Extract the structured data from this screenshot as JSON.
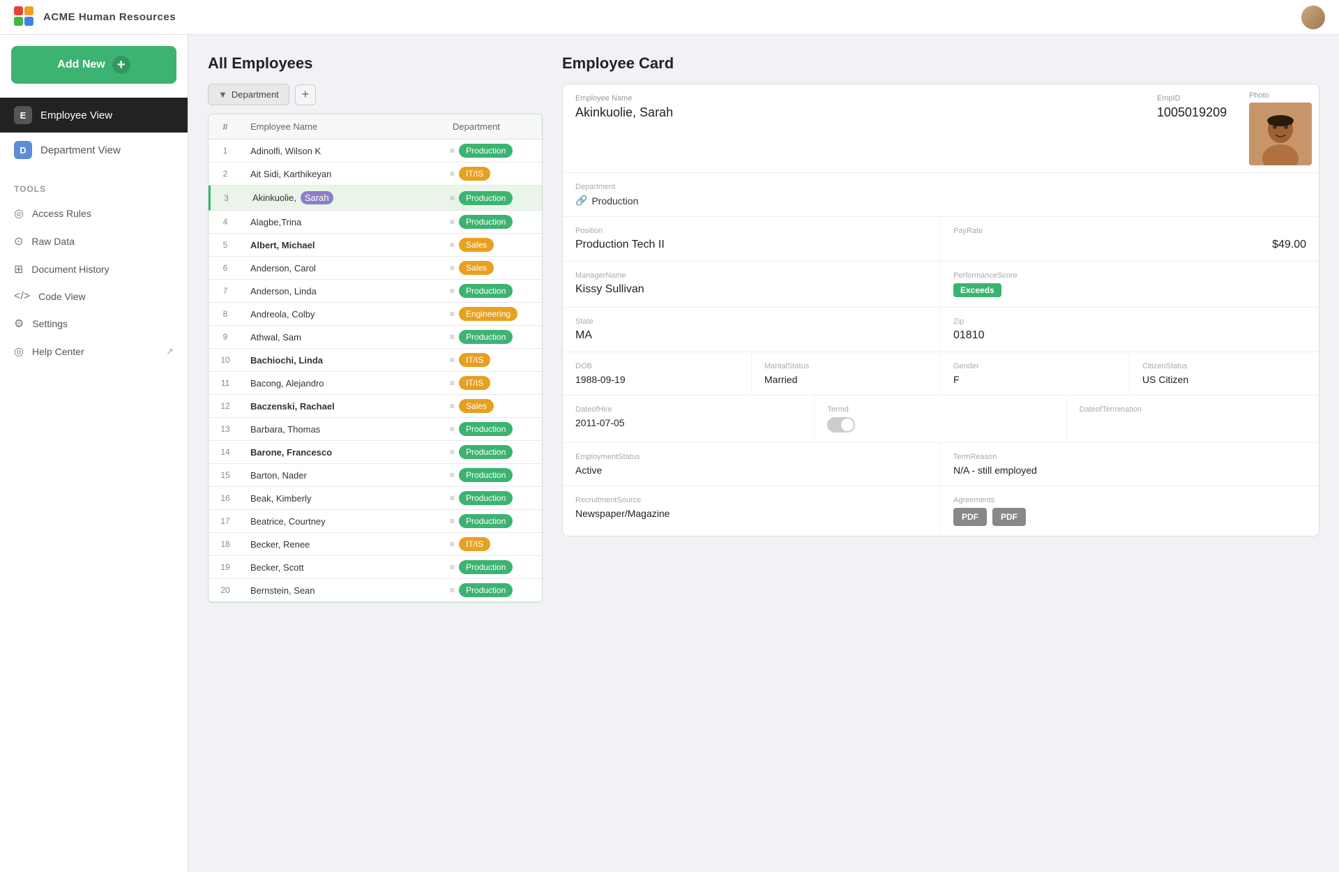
{
  "app": {
    "title": "ACME Human Resources",
    "logo_unicode": "⊞"
  },
  "topbar": {
    "avatar_alt": "User Avatar"
  },
  "sidebar": {
    "add_new_label": "Add New",
    "add_new_plus": "+",
    "nav_items": [
      {
        "id": "employee-view",
        "label": "Employee View",
        "icon": "E",
        "active": true
      },
      {
        "id": "department-view",
        "label": "Department View",
        "icon": "D",
        "active": false
      }
    ],
    "tools_label": "TOOLS",
    "tools": [
      {
        "id": "access-rules",
        "label": "Access Rules",
        "icon": "◎"
      },
      {
        "id": "raw-data",
        "label": "Raw Data",
        "icon": "⊙"
      },
      {
        "id": "document-history",
        "label": "Document History",
        "icon": "⊞"
      },
      {
        "id": "code-view",
        "label": "Code View",
        "icon": "</>"
      },
      {
        "id": "settings",
        "label": "Settings",
        "icon": "⚙"
      },
      {
        "id": "help-center",
        "label": "Help Center",
        "icon": "◎",
        "has_ext": true
      }
    ]
  },
  "employees_section": {
    "title": "All Employees",
    "filter_label": "Department",
    "filter_icon": "▼",
    "add_filter": "+",
    "columns": [
      "Employee Name",
      "Department"
    ],
    "employees": [
      {
        "num": 1,
        "name": "Adinolfi, Wilson  K",
        "bold": false,
        "dept": "Production",
        "dept_class": "production"
      },
      {
        "num": 2,
        "name": "Ait Sidi, Karthikeyan",
        "bold": false,
        "dept": "IT/IS",
        "dept_class": "it"
      },
      {
        "num": 3,
        "name": "Akinkuolie, Sarah",
        "bold": false,
        "dept": "Production",
        "dept_class": "production",
        "selected": true
      },
      {
        "num": 4,
        "name": "Alagbe,Trina",
        "bold": false,
        "dept": "Production",
        "dept_class": "production"
      },
      {
        "num": 5,
        "name": "Albert, Michael",
        "bold": true,
        "dept": "Sales",
        "dept_class": "sales"
      },
      {
        "num": 6,
        "name": "Anderson, Carol",
        "bold": false,
        "dept": "Sales",
        "dept_class": "sales"
      },
      {
        "num": 7,
        "name": "Anderson, Linda",
        "bold": false,
        "dept": "Production",
        "dept_class": "production"
      },
      {
        "num": 8,
        "name": "Andreola, Colby",
        "bold": false,
        "dept": "Engineering",
        "dept_class": "engineering"
      },
      {
        "num": 9,
        "name": "Athwal, Sam",
        "bold": false,
        "dept": "Production",
        "dept_class": "production"
      },
      {
        "num": 10,
        "name": "Bachiochi, Linda",
        "bold": true,
        "dept": "IT/IS",
        "dept_class": "it"
      },
      {
        "num": 11,
        "name": "Bacong, Alejandro",
        "bold": false,
        "dept": "IT/IS",
        "dept_class": "it"
      },
      {
        "num": 12,
        "name": "Baczenski, Rachael",
        "bold": true,
        "dept": "Sales",
        "dept_class": "sales"
      },
      {
        "num": 13,
        "name": "Barbara, Thomas",
        "bold": false,
        "dept": "Production",
        "dept_class": "production"
      },
      {
        "num": 14,
        "name": "Barone, Francesco",
        "bold": true,
        "dept": "Production",
        "dept_class": "production"
      },
      {
        "num": 15,
        "name": "Barton, Nader",
        "bold": false,
        "dept": "Production",
        "dept_class": "production"
      },
      {
        "num": 16,
        "name": "Beak, Kimberly",
        "bold": false,
        "dept": "Production",
        "dept_class": "production"
      },
      {
        "num": 17,
        "name": "Beatrice, Courtney",
        "bold": false,
        "dept": "Production",
        "dept_class": "production"
      },
      {
        "num": 18,
        "name": "Becker, Renee",
        "bold": false,
        "dept": "IT/IS",
        "dept_class": "it"
      },
      {
        "num": 19,
        "name": "Becker, Scott",
        "bold": false,
        "dept": "Production",
        "dept_class": "production"
      },
      {
        "num": 20,
        "name": "Bernstein, Sean",
        "bold": false,
        "dept": "Production",
        "dept_class": "production"
      }
    ]
  },
  "employee_card": {
    "title": "Employee Card",
    "fields": {
      "employee_name_label": "Employee Name",
      "employee_name": "Akinkuolie, Sarah",
      "emp_id_label": "EmpID",
      "emp_id": "1005019209",
      "photo_label": "Photo",
      "department_label": "Department",
      "department": "Production",
      "position_label": "Position",
      "position": "Production Tech II",
      "pay_rate_label": "PayRate",
      "pay_rate": "$49.00",
      "manager_name_label": "ManagerName",
      "manager_name": "Kissy Sullivan",
      "performance_score_label": "PerformanceScore",
      "performance_score": "Exceeds",
      "state_label": "State",
      "state": "MA",
      "zip_label": "Zip",
      "zip": "01810",
      "dob_label": "DOB",
      "dob": "1988-09-19",
      "marital_status_label": "MaritalStatus",
      "marital_status": "Married",
      "gender_label": "Gender",
      "gender": "F",
      "citizen_status_label": "CitizenStatus",
      "citizen_status": "US Citizen",
      "date_of_hire_label": "DateofHire",
      "date_of_hire": "2011-07-05",
      "termd_label": "Termd",
      "date_of_termination_label": "DateofTermination",
      "employment_status_label": "EmploymentStatus",
      "employment_status": "Active",
      "term_reason_label": "TermReason",
      "term_reason": "N/A - still employed",
      "recruitment_source_label": "RecruitmentSource",
      "recruitment_source": "Newspaper/Magazine",
      "agreements_label": "Agreements",
      "pdf_label_1": "PDF",
      "pdf_label_2": "PDF"
    }
  }
}
